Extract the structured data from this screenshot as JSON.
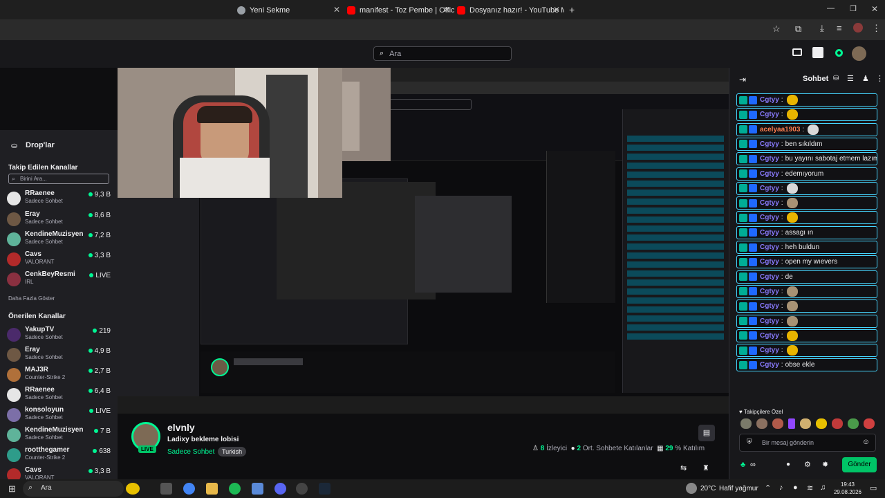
{
  "browser": {
    "tabs": [
      {
        "title": "Yeni Sekme",
        "icon": "chrome-icon"
      },
      {
        "title": "manifest - Toz Pembe | Official Vi",
        "icon": "youtube-icon"
      },
      {
        "title": "Dosyanız hazır! - YouTube MP3",
        "icon": "youtube-icon"
      }
    ],
    "new_tab": "+"
  },
  "topnav": {
    "search_placeholder": "Ara"
  },
  "sidebar": {
    "drops_label": "Drop'lar",
    "followed_title": "Takip Edilen Kanallar",
    "search_placeholder": "Birini Ara...",
    "followed": [
      {
        "name": "RRaenee",
        "game": "Sadece Sohbet",
        "viewers": "9,3 B",
        "live": true
      },
      {
        "name": "Eray",
        "game": "Sadece Sohbet",
        "viewers": "8,6 B",
        "live": true
      },
      {
        "name": "KendineMuzisyen",
        "game": "Sadece Sohbet",
        "viewers": "7,2 B",
        "live": true
      },
      {
        "name": "Cavs",
        "game": "VALORANT",
        "viewers": "3,3 B",
        "live": true
      },
      {
        "name": "CenkBeyResmi",
        "game": "IRL",
        "viewers": "LIVE",
        "live": true
      }
    ],
    "show_more": "Daha Fazla Göster",
    "recommended_title": "Önerilen Kanallar",
    "recommended": [
      {
        "name": "YakupTV",
        "game": "Sadece Sohbet",
        "viewers": "219"
      },
      {
        "name": "Eray",
        "game": "Sadece Sohbet",
        "viewers": "4,9 B"
      },
      {
        "name": "MAJ3R",
        "game": "Counter-Strike 2",
        "viewers": "2,7 B"
      },
      {
        "name": "RRaenee",
        "game": "Sadece Sohbet",
        "viewers": "6,4 B"
      },
      {
        "name": "konsoloyun",
        "game": "Sadece Sohbet",
        "viewers": "LIVE"
      },
      {
        "name": "KendineMuzisyen",
        "game": "Sadece Sohbet",
        "viewers": "7 B"
      },
      {
        "name": "rootthegamer",
        "game": "Counter-Strike 2",
        "viewers": "638"
      },
      {
        "name": "Cavs",
        "game": "VALORANT",
        "viewers": "3,3 B"
      }
    ]
  },
  "stream": {
    "streamer": "elvnly",
    "title": "Ladixy bekleme lobisi",
    "category": "Sadece Sohbet",
    "tag": "Turkish",
    "live_badge": "LIVE",
    "viewers": "8",
    "viewers_label": "İzleyici",
    "chatters": "2",
    "chatters_label": "Ort. Sohbete Katılanlar",
    "participation": "29",
    "participation_label": "% Katılım"
  },
  "chat": {
    "title": "Sohbet",
    "messages": [
      {
        "user": "Cgtyy",
        "text": "",
        "emote": "#e8b400"
      },
      {
        "user": "Cgtyy",
        "text": "",
        "emote": "#e8b400"
      },
      {
        "user": "acelyaa1903",
        "text": "",
        "emote": "#d9d9d9",
        "color": "#ff7f50"
      },
      {
        "user": "Cgtyy",
        "text": "ben sıkıldım"
      },
      {
        "user": "Cgtyy",
        "text": "bu yayını sabotaj etmem lazım"
      },
      {
        "user": "Cgtyy",
        "text": "edemıyorum"
      },
      {
        "user": "Cgtyy",
        "text": "",
        "emote": "#d9d9d9"
      },
      {
        "user": "Cgtyy",
        "text": "",
        "emote": "#a89274"
      },
      {
        "user": "Cgtyy",
        "text": "",
        "emote": "#e8b400"
      },
      {
        "user": "Cgtyy",
        "text": "assagı ın"
      },
      {
        "user": "Cgtyy",
        "text": "heh buldun"
      },
      {
        "user": "Cgtyy",
        "text": "open my wıevers"
      },
      {
        "user": "Cgtyy",
        "text": "de"
      },
      {
        "user": "Cgtyy",
        "text": "",
        "emote": "#a89274"
      },
      {
        "user": "Cgtyy",
        "text": "",
        "emote": "#a89274"
      },
      {
        "user": "Cgtyy",
        "text": "",
        "emote": "#a89274"
      },
      {
        "user": "Cgtyy",
        "text": "",
        "emote": "#e8b400"
      },
      {
        "user": "Cgtyy",
        "text": "",
        "emote": "#e8b400"
      },
      {
        "user": "Cgtyy",
        "text": "obse ekle"
      }
    ],
    "followers_label": "Takipçilere Özel",
    "input_placeholder": "Bir mesaj gönderin",
    "send_label": "Gönder"
  },
  "taskbar": {
    "search": "Ara",
    "weather": "20°C",
    "weather_text": "Hafif yağmur",
    "time": "19:43",
    "date": "29.08.2026"
  }
}
